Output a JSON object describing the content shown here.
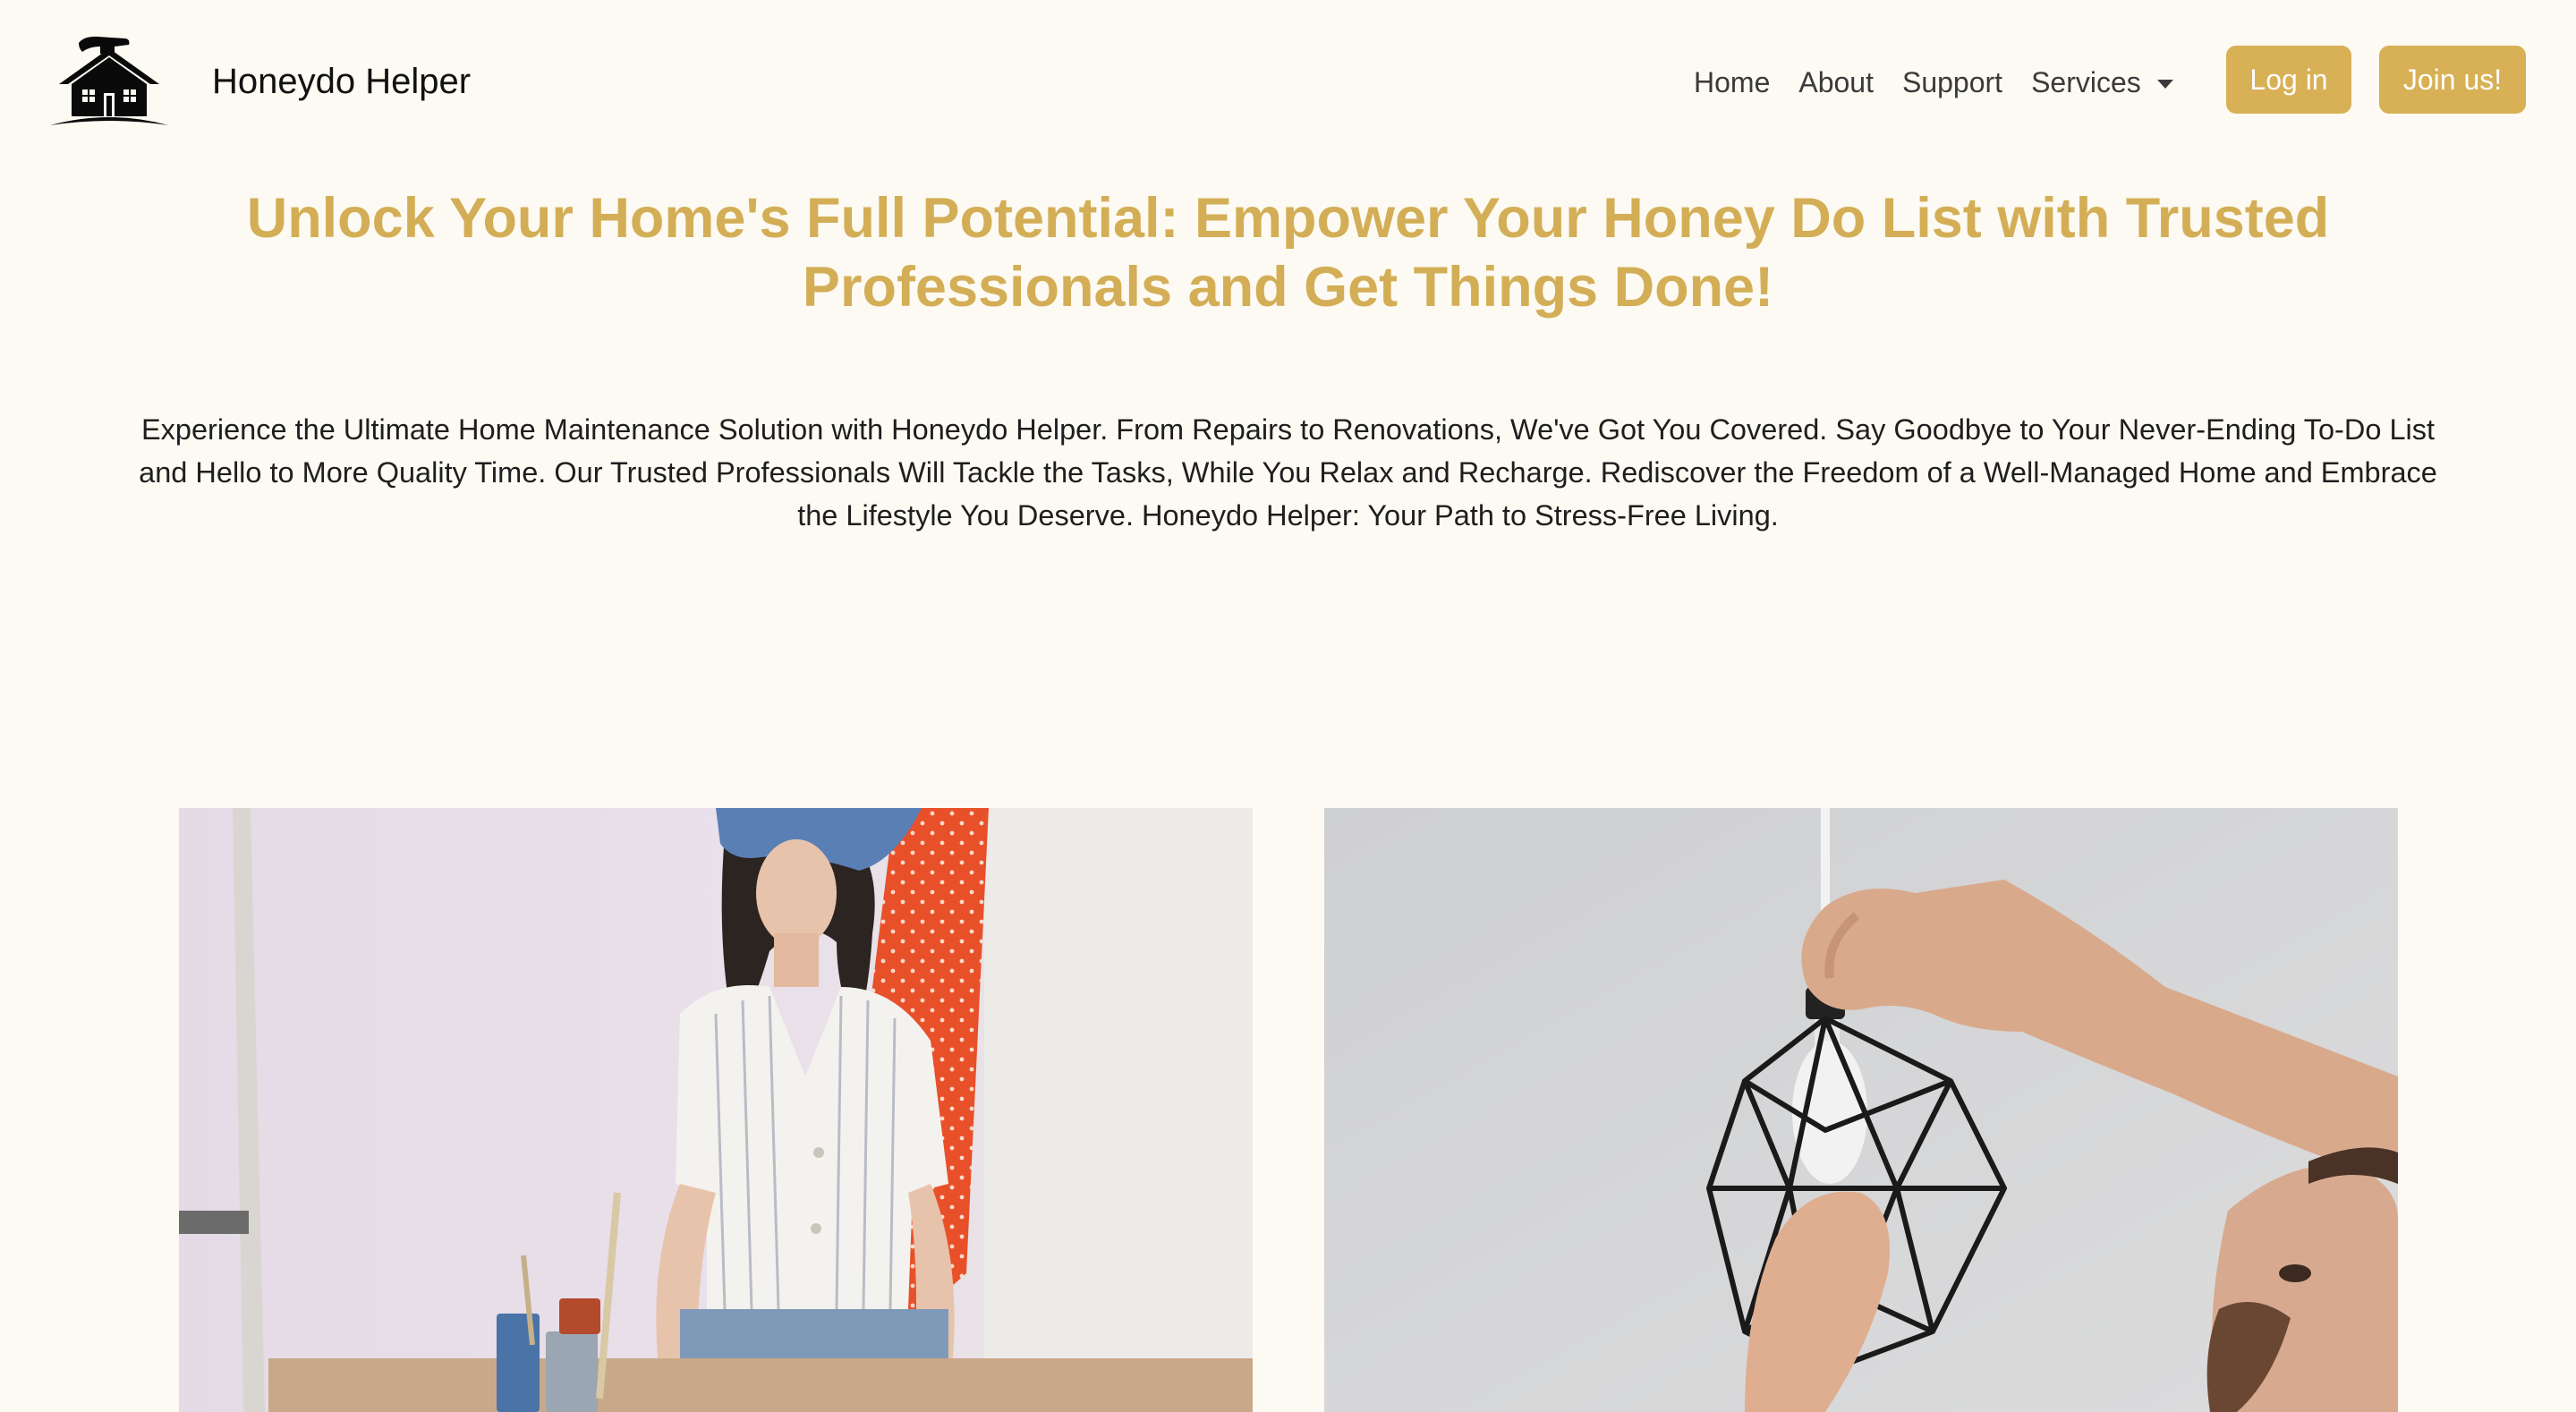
{
  "brand": {
    "name": "Honeydo Helper",
    "logo_icon": "house-hammer-icon"
  },
  "nav": {
    "links": [
      "Home",
      "About",
      "Support",
      "Services"
    ],
    "services_dropdown_icon": "caret-down-icon",
    "login_label": "Log in",
    "join_label": "Join us!"
  },
  "hero": {
    "title": "Unlock Your Home's Full Potential: Empower Your Honey Do List with Trusted Professionals and Get Things Done!",
    "description": "Experience the Ultimate Home Maintenance Solution with Honeydo Helper. From Repairs to Renovations, We've Got You Covered. Say Goodbye to Your Never-Ending To-Do List and Hello to More Quality Time. Our Trusted Professionals Will Tackle the Tasks, While You Relax and Recharge. Rediscover the Freedom of a Well-Managed Home and Embrace the Lifestyle You Deserve. Honeydo Helper: Your Path to Stress-Free Living."
  },
  "colors": {
    "background": "#fcfaf2",
    "accent": "#d8b055",
    "title": "#d3ae56"
  },
  "photos": [
    {
      "subject": "woman-painting-photo"
    },
    {
      "subject": "man-installing-light-fixture-photo"
    }
  ]
}
